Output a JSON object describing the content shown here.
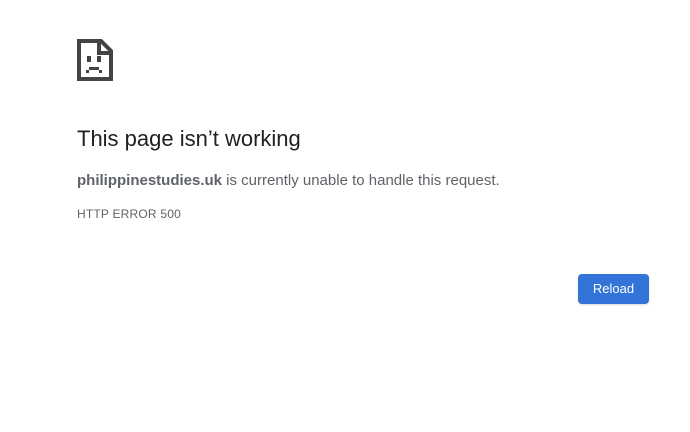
{
  "error_page": {
    "icon": "sad-document-icon",
    "title": "This page isn’t working",
    "domain": "philippinestudies.uk",
    "message_suffix": " is currently unable to handle this request.",
    "error_code": "HTTP ERROR 500",
    "reload_label": "Reload"
  },
  "colors": {
    "title": "#202124",
    "text": "#5f6368",
    "button": "#3274d8",
    "icon": "#444444"
  }
}
